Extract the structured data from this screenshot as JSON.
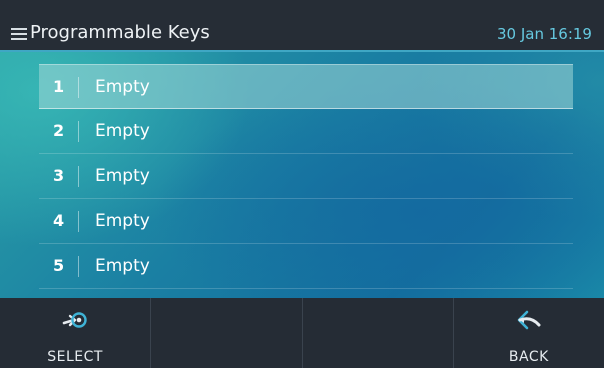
{
  "header": {
    "title": "Programmable Keys",
    "clock": "30 Jan 16:19",
    "menu_icon": "hamburger-menu-icon",
    "accent_color": "#3fa7c4"
  },
  "list": {
    "selected_index": 0,
    "items": [
      {
        "number": "1",
        "label": "Empty"
      },
      {
        "number": "2",
        "label": "Empty"
      },
      {
        "number": "3",
        "label": "Empty"
      },
      {
        "number": "4",
        "label": "Empty"
      },
      {
        "number": "5",
        "label": "Empty"
      }
    ]
  },
  "softkeys": [
    {
      "label": "SELECT",
      "icon": "select-arrow-icon"
    },
    {
      "label": "",
      "icon": ""
    },
    {
      "label": "",
      "icon": ""
    },
    {
      "label": "BACK",
      "icon": "back-arrow-icon"
    }
  ]
}
